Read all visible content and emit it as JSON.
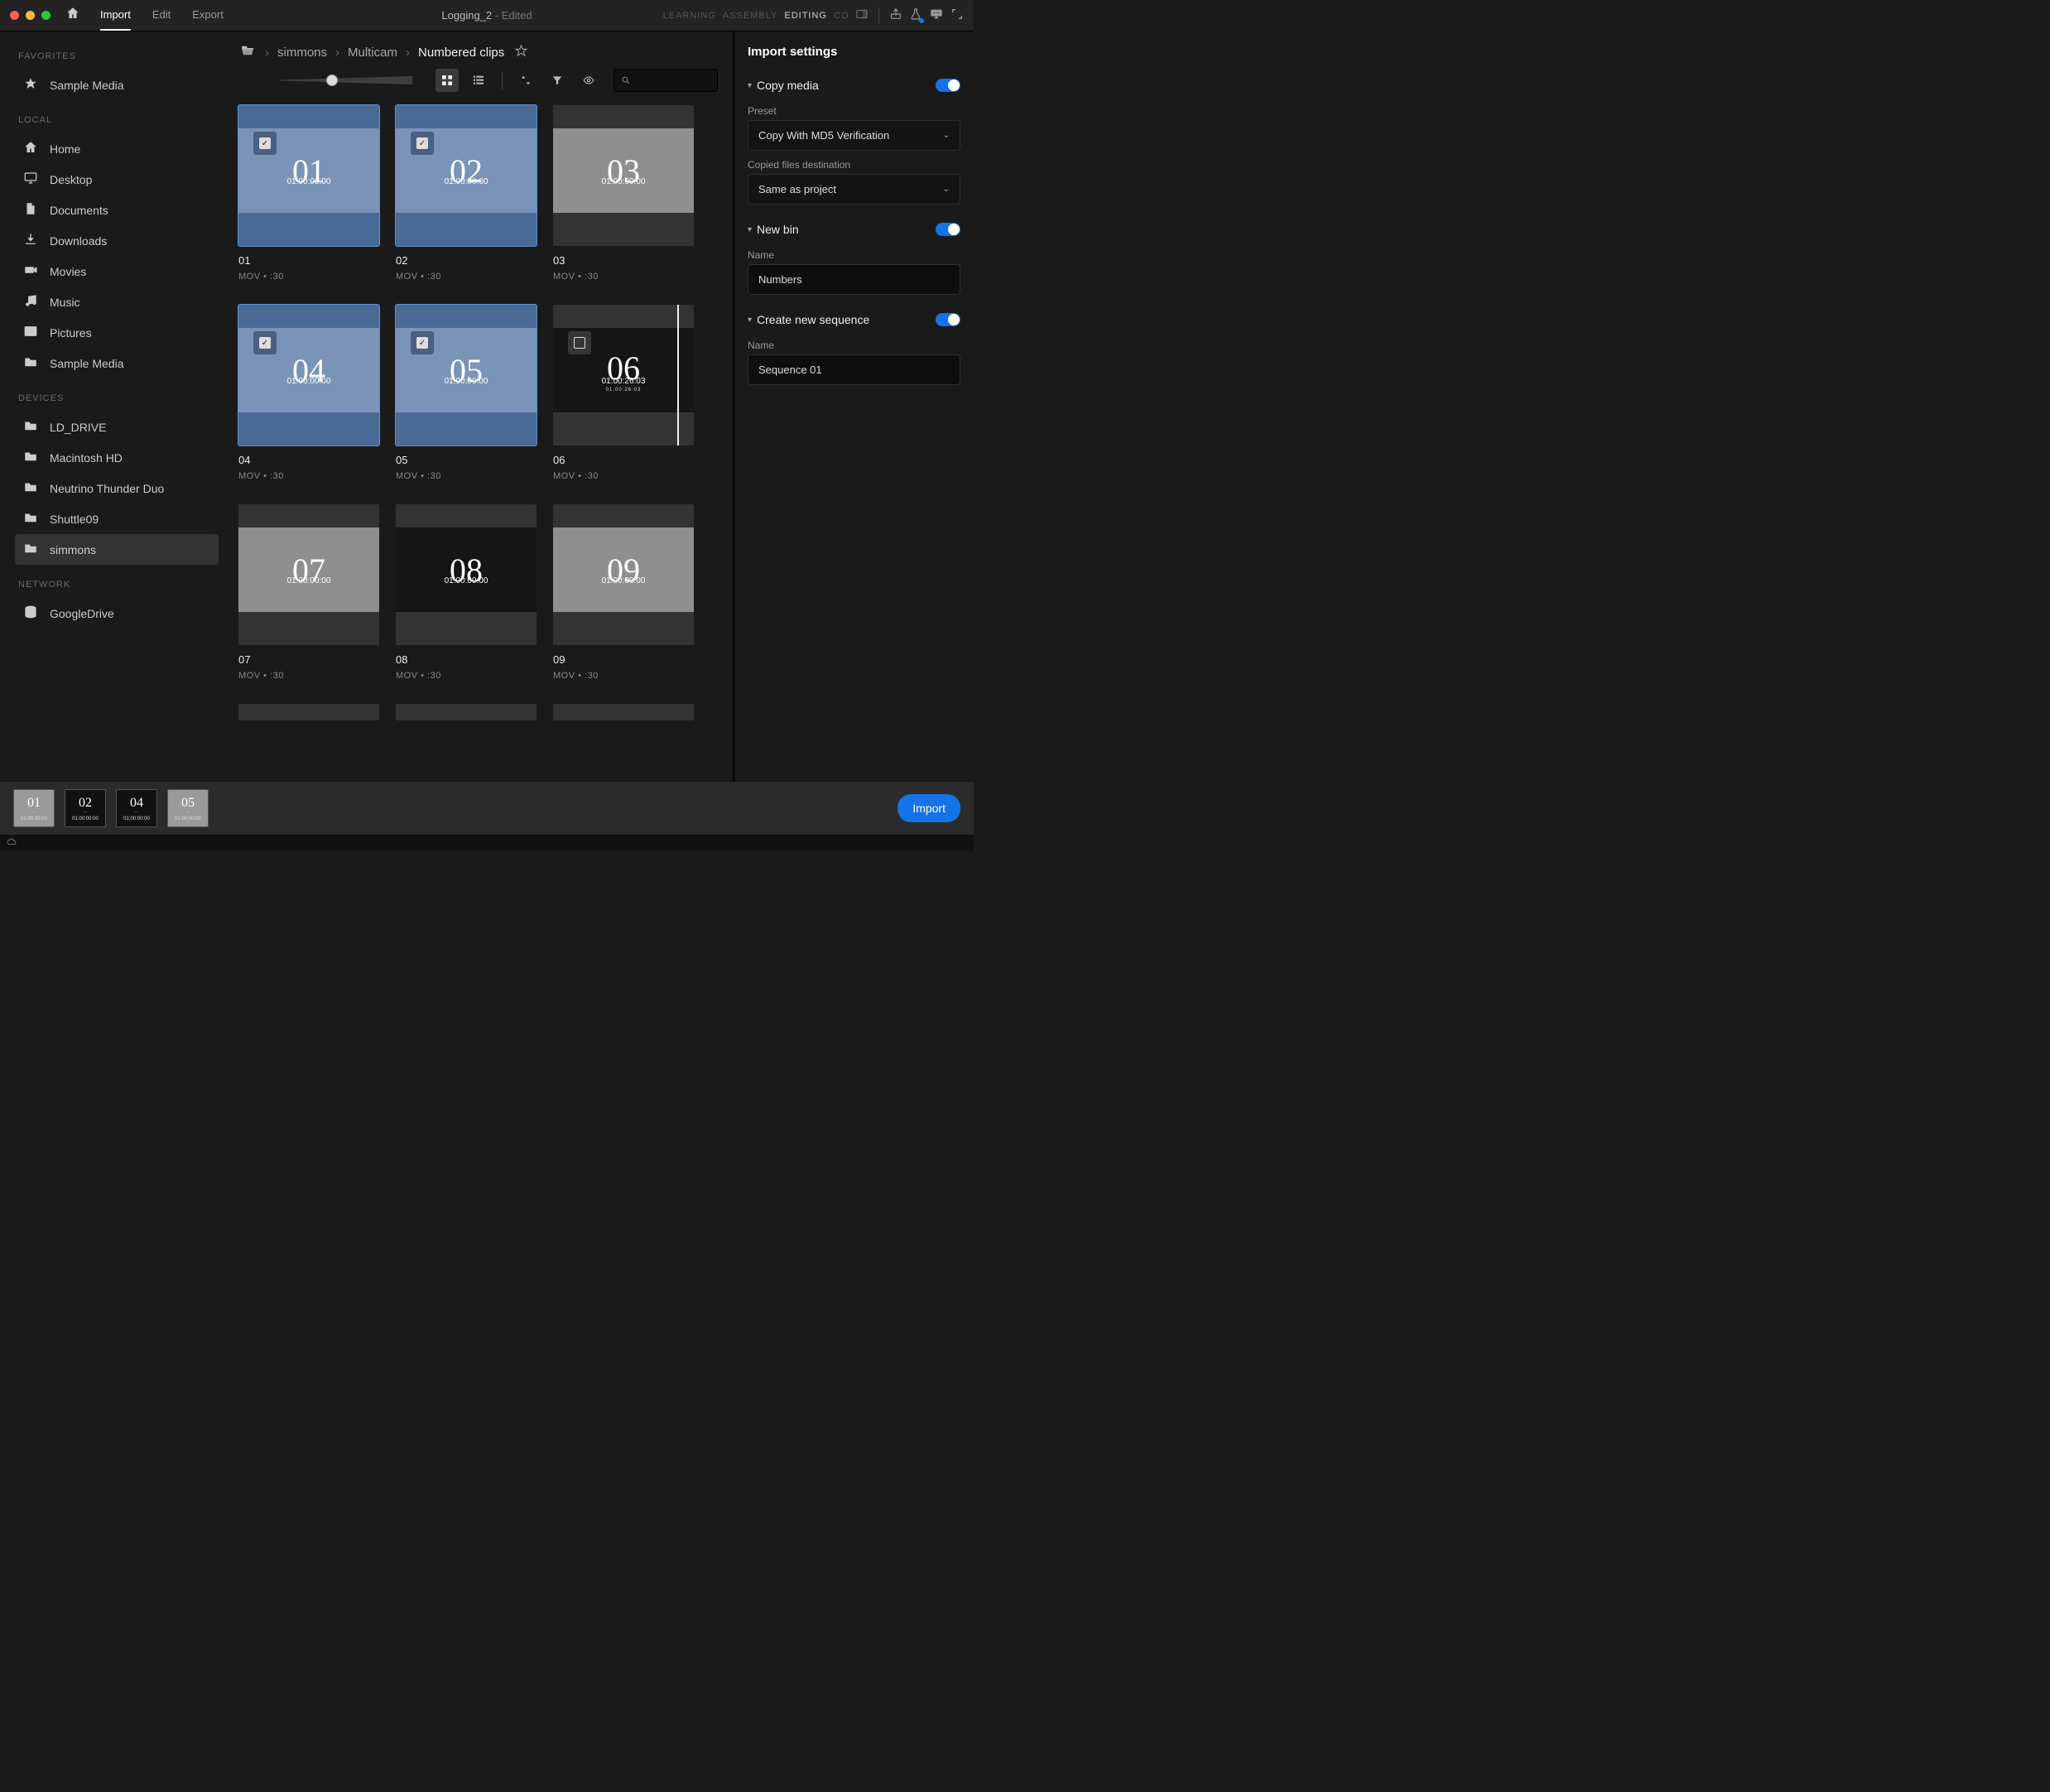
{
  "topbar": {
    "home_icon": "⌂",
    "tabs": {
      "import": "Import",
      "edit": "Edit",
      "export": "Export"
    },
    "doc_title": "Logging_2",
    "doc_suffix": " - Edited",
    "workspaces": {
      "learning": "LEARNING",
      "assembly": "ASSEMBLY",
      "editing": "EDITING",
      "color_trunc": "CO"
    }
  },
  "sidebar": {
    "favorites_title": "FAVORITES",
    "favorites": [
      {
        "icon": "star",
        "label": "Sample Media"
      }
    ],
    "local_title": "LOCAL",
    "local": [
      {
        "icon": "home",
        "label": "Home"
      },
      {
        "icon": "desktop",
        "label": "Desktop"
      },
      {
        "icon": "doc",
        "label": "Documents"
      },
      {
        "icon": "download",
        "label": "Downloads"
      },
      {
        "icon": "movie",
        "label": "Movies"
      },
      {
        "icon": "music",
        "label": "Music"
      },
      {
        "icon": "picture",
        "label": "Pictures"
      },
      {
        "icon": "folder",
        "label": "Sample Media"
      }
    ],
    "devices_title": "DEVICES",
    "devices": [
      {
        "icon": "folder",
        "label": "LD_DRIVE"
      },
      {
        "icon": "folder",
        "label": "Macintosh HD"
      },
      {
        "icon": "folder",
        "label": "Neutrino Thunder Duo"
      },
      {
        "icon": "folder",
        "label": "Shuttle09"
      },
      {
        "icon": "folder",
        "label": "simmons",
        "active": true
      }
    ],
    "network_title": "NETWORK",
    "network": [
      {
        "icon": "db",
        "label": "GoogleDrive"
      }
    ]
  },
  "breadcrumb": {
    "items": [
      "simmons",
      "Multicam",
      "Numbered clips"
    ]
  },
  "toolbar": {
    "search_placeholder": ""
  },
  "clips": [
    {
      "num": "01",
      "name": "01",
      "tc": "01:00:00:00",
      "meta": "MOV  •  :30",
      "selected": true,
      "checked": true,
      "dark": false
    },
    {
      "num": "02",
      "name": "02",
      "tc": "01:00:00:00",
      "meta": "MOV  •  :30",
      "selected": true,
      "checked": true,
      "dark": false
    },
    {
      "num": "03",
      "name": "03",
      "tc": "01:00:00:00",
      "meta": "MOV  •  :30",
      "selected": false,
      "checked": false,
      "dark": false
    },
    {
      "num": "04",
      "name": "04",
      "tc": "01:00:00:00",
      "meta": "MOV  •  :30",
      "selected": true,
      "checked": true,
      "dark": false
    },
    {
      "num": "05",
      "name": "05",
      "tc": "01:00:00:00",
      "meta": "MOV  •  :30",
      "selected": true,
      "checked": true,
      "dark": false
    },
    {
      "num": "06",
      "name": "06",
      "tc": "01:00:26:03",
      "sub": "01:00:26:03",
      "meta": "MOV  •  :30",
      "selected": false,
      "checked": false,
      "dark": true,
      "hover": true,
      "playhead_pct": 88
    },
    {
      "num": "07",
      "name": "07",
      "tc": "01:00:00:00",
      "meta": "MOV  •  :30",
      "selected": false,
      "checked": false,
      "dark": false
    },
    {
      "num": "08",
      "name": "08",
      "tc": "01:00:00:00",
      "meta": "MOV  •  :30",
      "selected": false,
      "checked": false,
      "dark": true
    },
    {
      "num": "09",
      "name": "09",
      "tc": "01:00:00:00",
      "meta": "MOV  •  :30",
      "selected": false,
      "checked": false,
      "dark": false
    }
  ],
  "tray": {
    "thumbs": [
      {
        "num": "01",
        "tc": "01:00:00:00",
        "dark": false
      },
      {
        "num": "02",
        "tc": "01:00:00:00",
        "dark": true
      },
      {
        "num": "04",
        "tc": "01:00:00:00",
        "dark": true
      },
      {
        "num": "05",
        "tc": "01:00:00:00",
        "dark": false
      }
    ],
    "import_btn": "Import"
  },
  "settings": {
    "panel_title": "Import settings",
    "copy_media": {
      "label": "Copy media",
      "on": true,
      "preset_label": "Preset",
      "preset_value": "Copy With MD5 Verification",
      "dest_label": "Copied files destination",
      "dest_value": "Same as project"
    },
    "new_bin": {
      "label": "New bin",
      "on": true,
      "name_label": "Name",
      "name_value": "Numbers"
    },
    "new_seq": {
      "label": "Create new sequence",
      "on": true,
      "name_label": "Name",
      "name_value": "Sequence 01"
    }
  }
}
